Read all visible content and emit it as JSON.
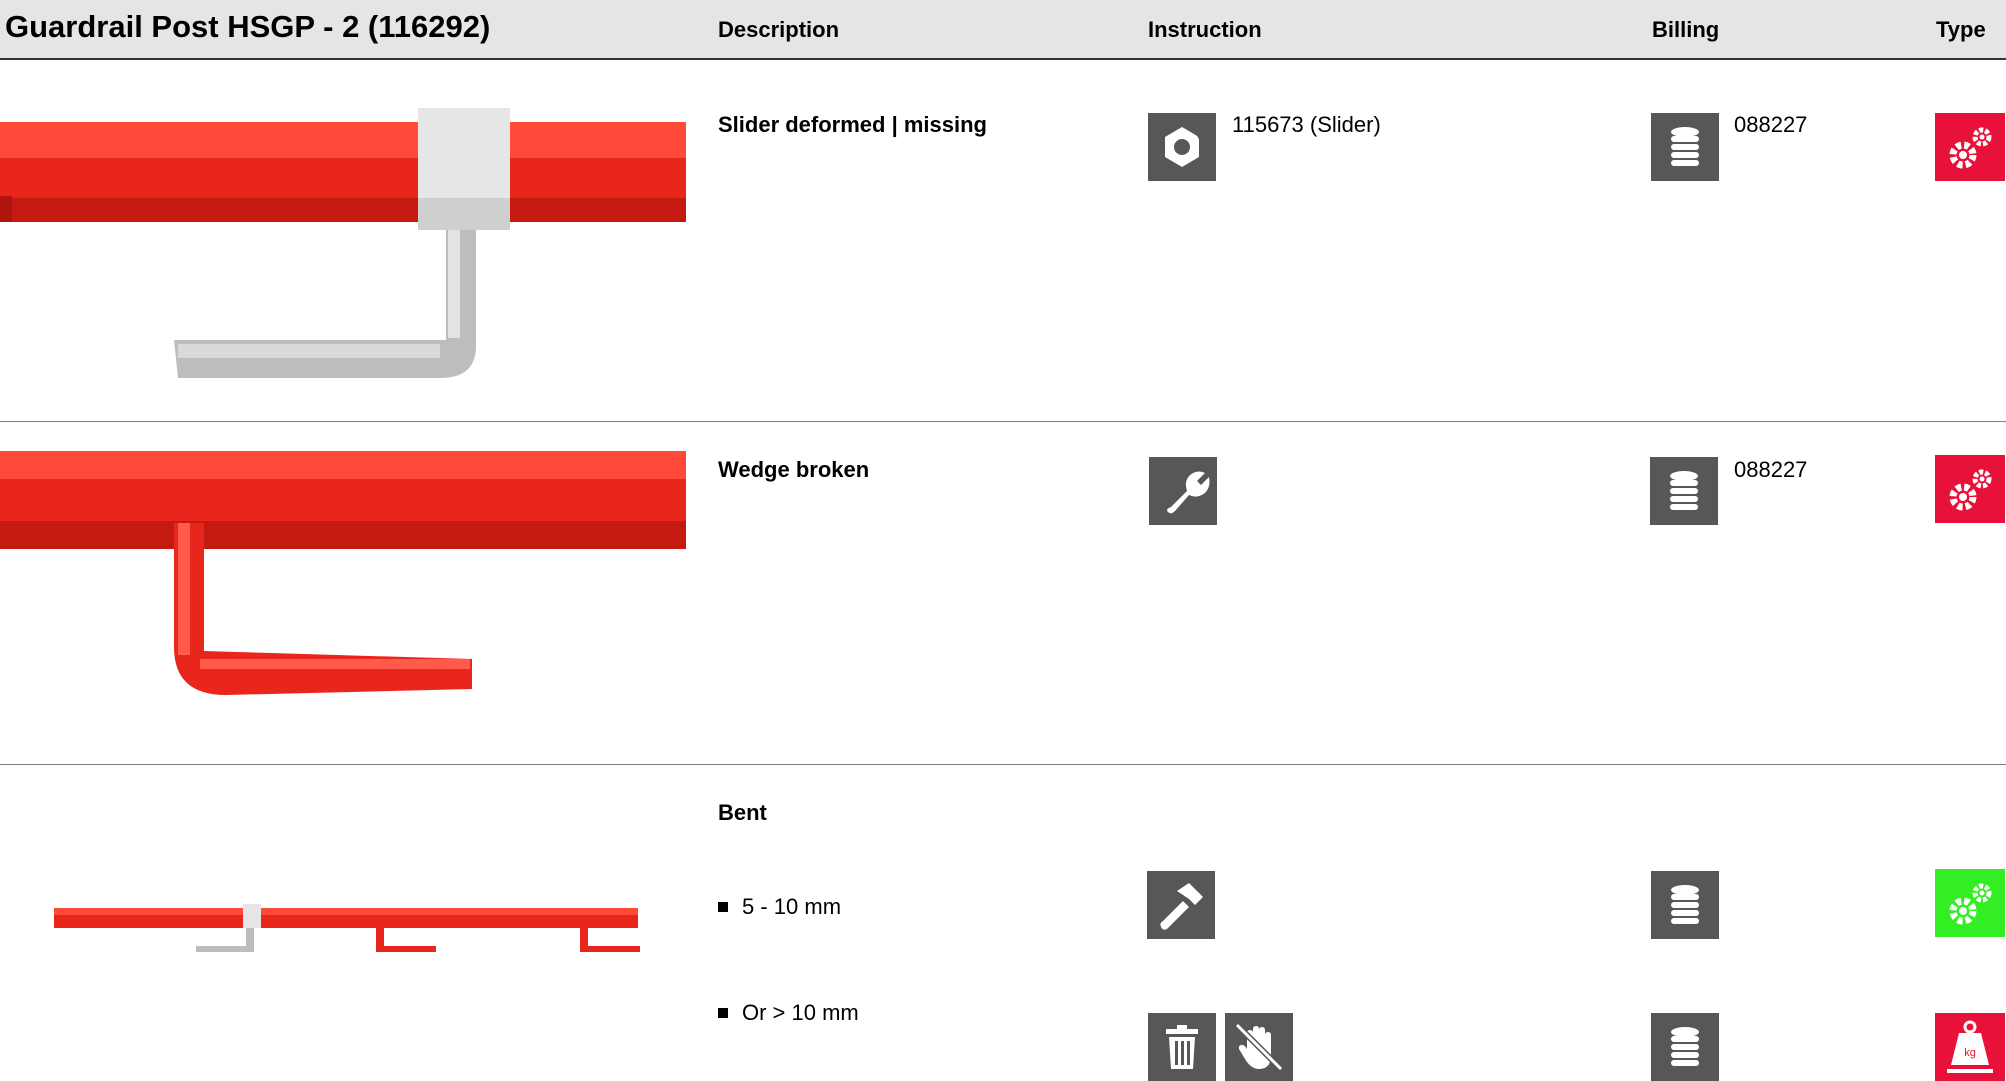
{
  "header": {
    "title": "Guardrail Post HSGP - 2 (116292)",
    "col_description": "Description",
    "col_instruction": "Instruction",
    "col_billing": "Billing",
    "col_type": "Type"
  },
  "rows": [
    {
      "description": "Slider deformed | missing",
      "instruction_icon": "nut-icon",
      "instruction_text": "115673 (Slider)",
      "billing_icon": "coin-stack-icon",
      "billing_text": "088227",
      "type_icon": "gears-icon",
      "type_color": "#e8113a"
    },
    {
      "description": "Wedge broken",
      "instruction_icon": "wrench-icon",
      "billing_icon": "coin-stack-icon",
      "billing_text": "088227",
      "type_icon": "gears-icon",
      "type_color": "#e8113a"
    },
    {
      "description": "Bent",
      "subitems": [
        {
          "label": "5 - 10 mm",
          "instruction_icon": "hammer-icon",
          "billing_icon": "coin-stack-icon",
          "type_icon": "gears-icon",
          "type_color": "#33ee22"
        },
        {
          "label": "Or > 10 mm",
          "instruction_icons": [
            "trash-icon",
            "no-touch-hand-icon"
          ],
          "billing_icon": "coin-stack-icon",
          "type_icon": "weight-kg-icon",
          "type_color": "#e8113a"
        }
      ]
    }
  ],
  "colors": {
    "header_bg": "#e5e5e5",
    "icon_bg": "#575757",
    "part_red": "#e8261c",
    "part_grey": "#c8c8c8"
  }
}
